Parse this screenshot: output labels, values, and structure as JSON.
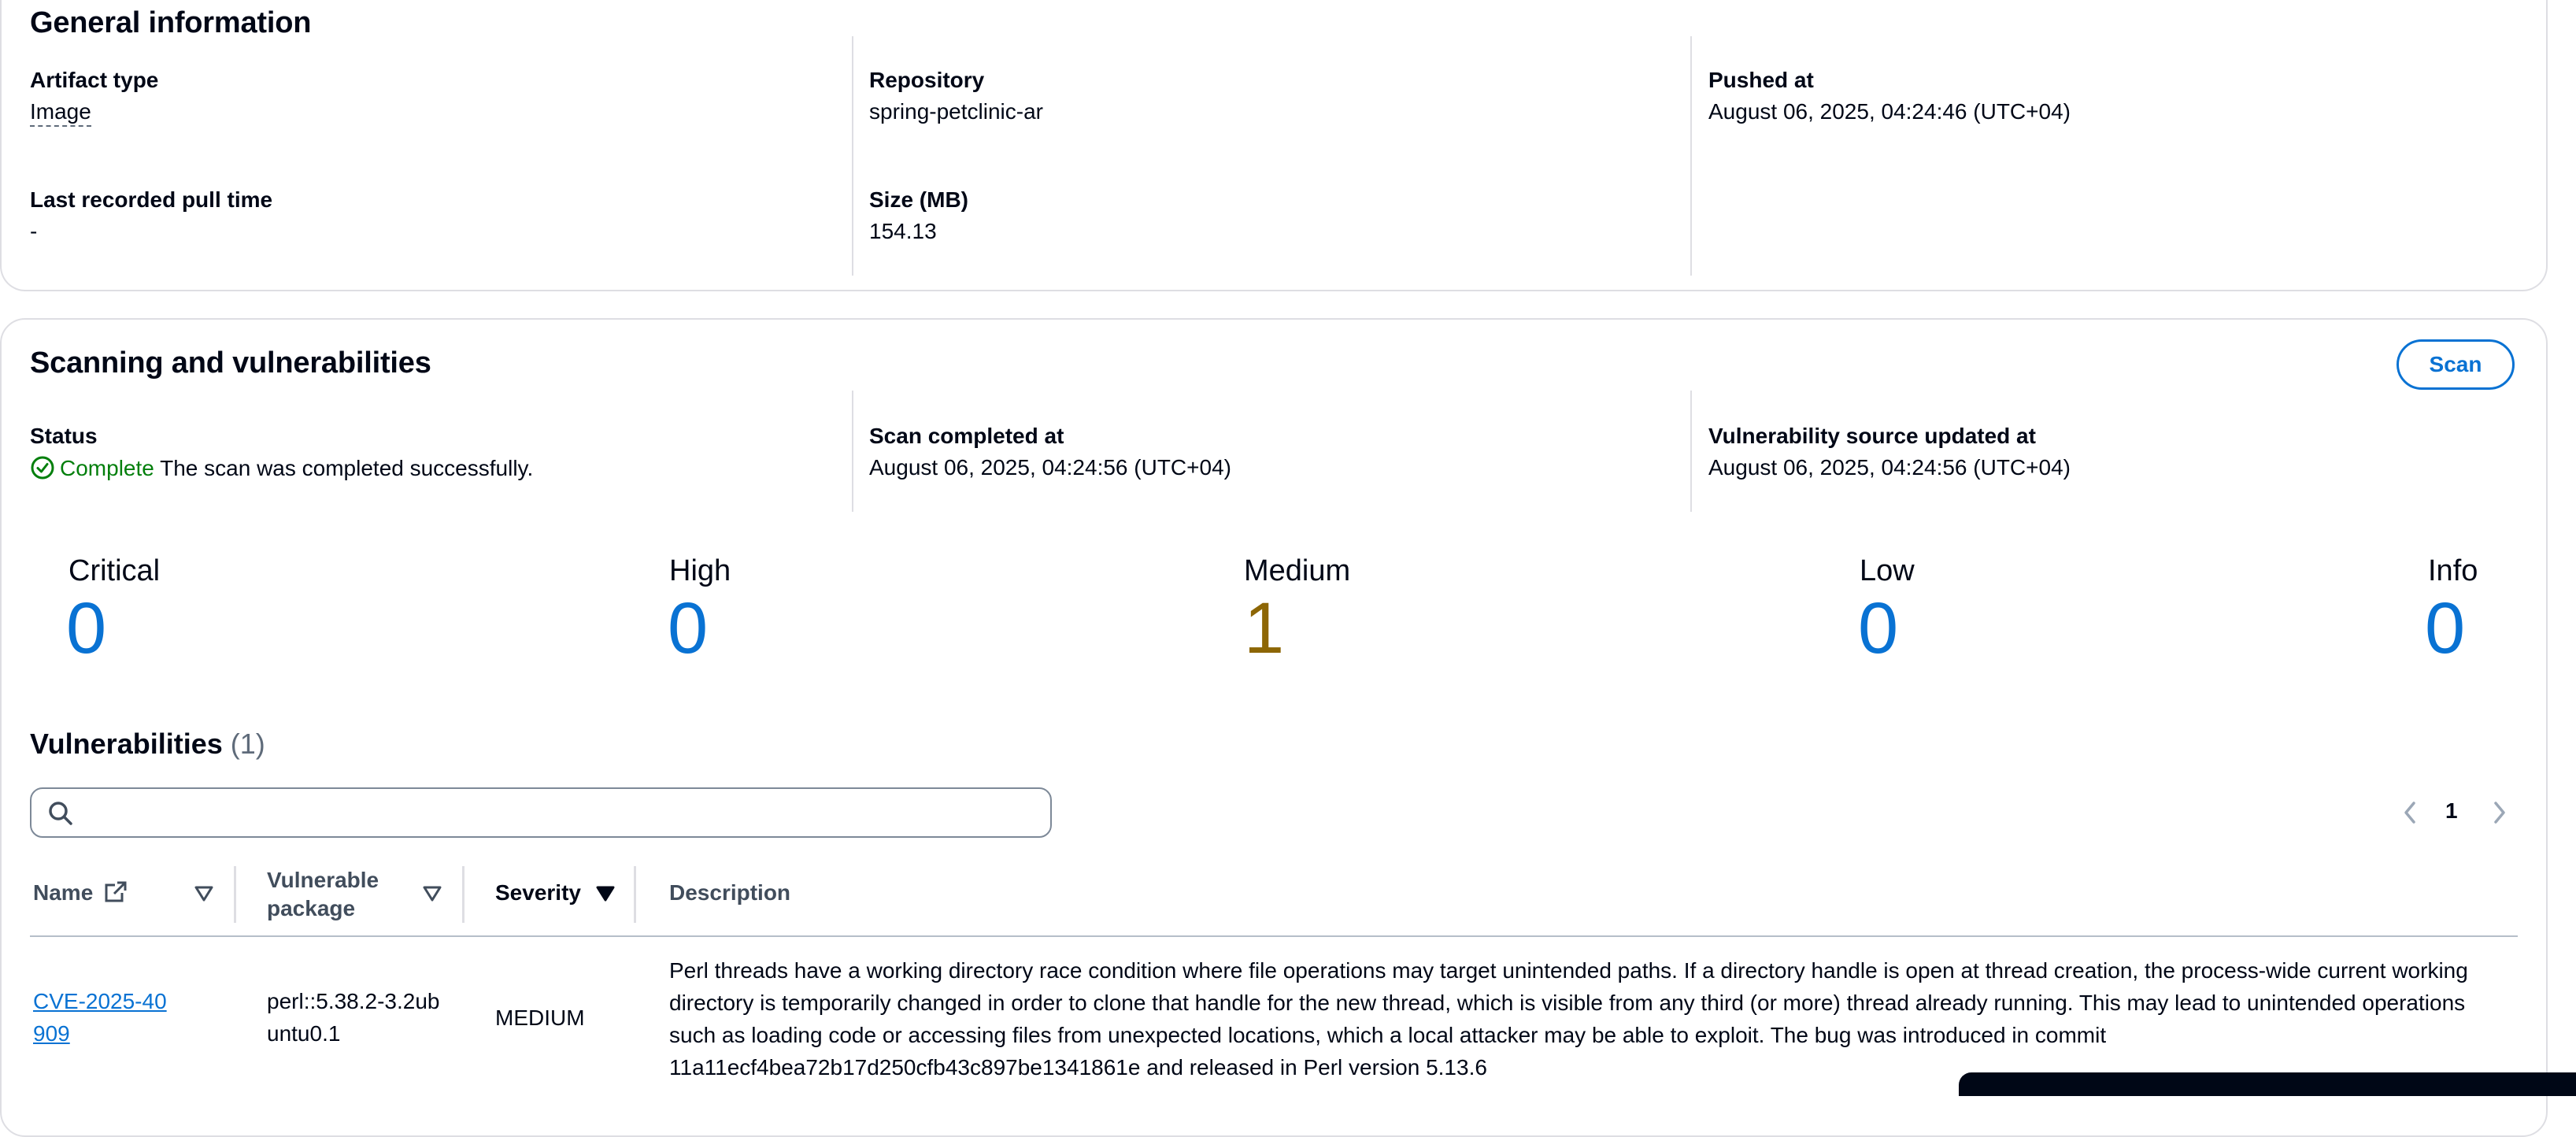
{
  "general": {
    "title": "General information",
    "artifact_type": {
      "label": "Artifact type",
      "value": "Image"
    },
    "repository": {
      "label": "Repository",
      "value": "spring-petclinic-ar"
    },
    "pushed_at": {
      "label": "Pushed at",
      "value": "August 06, 2025, 04:24:46 (UTC+04)"
    },
    "last_pull": {
      "label": "Last recorded pull time",
      "value": "-"
    },
    "size": {
      "label": "Size (MB)",
      "value": "154.13"
    }
  },
  "scanning": {
    "title": "Scanning and vulnerabilities",
    "scan_button": "Scan",
    "status": {
      "label": "Status",
      "state": "Complete",
      "message": "The scan was completed successfully.",
      "icon": "check-circle-icon",
      "color": "#037f0c"
    },
    "scan_completed": {
      "label": "Scan completed at",
      "value": "August 06, 2025, 04:24:56 (UTC+04)"
    },
    "source_updated": {
      "label": "Vulnerability source updated at",
      "value": "August 06, 2025, 04:24:56 (UTC+04)"
    },
    "severity_counts": [
      {
        "label": "Critical",
        "count": "0",
        "color": "#0972d3"
      },
      {
        "label": "High",
        "count": "0",
        "color": "#0972d3"
      },
      {
        "label": "Medium",
        "count": "1",
        "color": "#8d6605"
      },
      {
        "label": "Low",
        "count": "0",
        "color": "#0972d3"
      },
      {
        "label": "Info",
        "count": "0",
        "color": "#0972d3"
      }
    ]
  },
  "vulnerabilities": {
    "title": "Vulnerabilities",
    "count": "(1)",
    "search_placeholder": "",
    "pagination": {
      "current_page": "1"
    },
    "columns": [
      "Name",
      "Vulnerable package",
      "Severity",
      "Description"
    ],
    "rows": [
      {
        "name": "CVE-2025-40909",
        "package": "perl::5.38.2-3.2ubuntu0.1",
        "severity": "MEDIUM",
        "description": "Perl threads have a working directory race condition where file operations may target unintended paths. If a directory handle is open at thread creation, the process-wide current working directory is temporarily changed in order to clone that handle for the new thread, which is visible from any third (or more) thread already running. This may lead to unintended operations such as loading code or accessing files from unexpected locations, which a local attacker may be able to exploit. The bug was introduced in commit 11a11ecf4bea72b17d250cfb43c897be1341861e and released in Perl version 5.13.6"
      }
    ]
  }
}
